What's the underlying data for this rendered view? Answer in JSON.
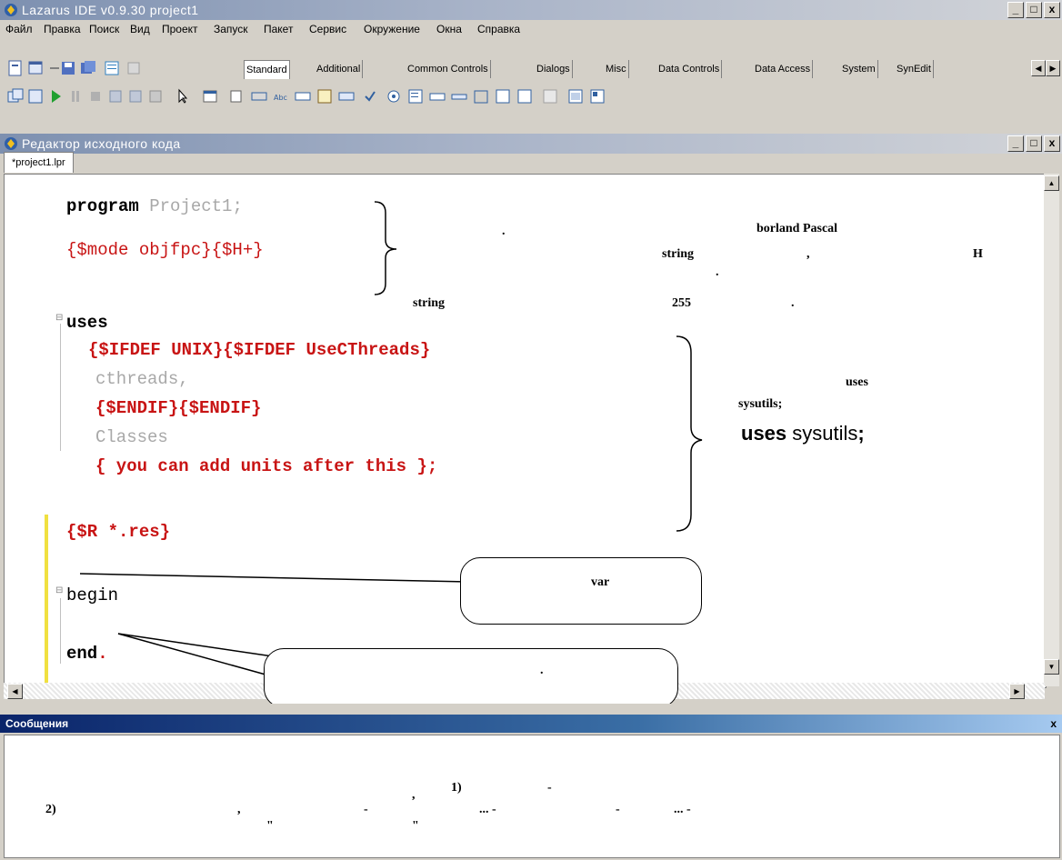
{
  "ide": {
    "title": "Lazarus IDE v0.9.30   project1",
    "menu": [
      "Файл",
      "Правка",
      "Поиск",
      "Вид",
      "Проект",
      "Запуск",
      "Пакет",
      "Сервис",
      "Окружение",
      "Окна",
      "Справка"
    ],
    "palette_tabs": [
      "Standard",
      "Additional",
      "Common Controls",
      "Dialogs",
      "Misc",
      "Data Controls",
      "Data Access",
      "System",
      "SynEdit"
    ],
    "win_buttons": [
      "_",
      "□",
      "x"
    ]
  },
  "editor": {
    "title": "Редактор исходного кода",
    "tab": "*project1.lpr",
    "code": {
      "l1_kw": "program",
      "l1_rest": " Project1;",
      "l2": "{$mode objfpc}{$H+}",
      "l3": "uses",
      "l4": "{$IFDEF UNIX}{$IFDEF UseCThreads}",
      "l5": "cthreads,",
      "l6": "{$ENDIF}{$ENDIF}",
      "l7": "Classes",
      "l8": "{ you can add units after this };",
      "l9": "{$R *.res}",
      "l10": "begin",
      "l11_kw": "end",
      "l11_dot": "."
    },
    "annotations": {
      "a_dot1": ".",
      "a_borland": "borland Pascal",
      "a_string1": "string",
      "a_comma": ",",
      "a_H": "H",
      "a_dot2": ".",
      "a_string2": "string",
      "a_255": "255",
      "a_dot3": ".",
      "a_uses1": "uses",
      "a_sysutils1": "sysutils;",
      "a_uses2": "uses",
      "a_sysutils2": " sysutils",
      "a_semicolon": ";",
      "a_var": "var",
      "a_dot4": "."
    }
  },
  "messages": {
    "title": "Сообщения",
    "close": "x",
    "line1_comma": ",",
    "line1_num": "1)",
    "line1_dash": "-",
    "line2_num": "2)",
    "line2_comma": ",",
    "line2_dash1": "-",
    "line2_dots1": "... -",
    "line2_dash2": "-",
    "line2_dots2": "... -",
    "line3_q1": "\"",
    "line3_q2": "\""
  }
}
